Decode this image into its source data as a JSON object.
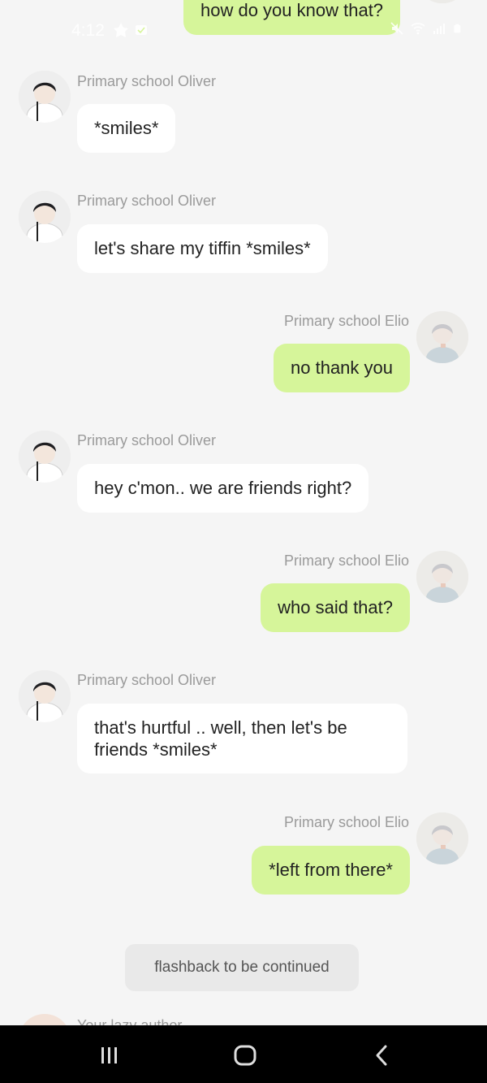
{
  "status_bar": {
    "time": "4:12"
  },
  "top_partial": {
    "text": "how do you know that?"
  },
  "messages": [
    {
      "sender": "Primary school Oliver",
      "text": "*smiles*"
    },
    {
      "sender": "Primary school Oliver",
      "text": "let's share my tiffin *smiles*"
    },
    {
      "sender": "Primary school Elio",
      "text": "no thank you"
    },
    {
      "sender": "Primary school Oliver",
      "text": "hey c'mon.. we are friends right?"
    },
    {
      "sender": "Primary school Elio",
      "text": "who said that?"
    },
    {
      "sender": "Primary school Oliver",
      "text": "that's hurtful .. well, then let's be friends *smiles*"
    },
    {
      "sender": "Primary school Elio",
      "text": "*left from there*"
    }
  ],
  "narration": {
    "text": "flashback to be continued"
  },
  "peek": {
    "sender": "Your lazy author"
  },
  "colors": {
    "outgoing_bubble": "#d6f59a",
    "incoming_bubble": "#ffffff",
    "background": "#f5f5f5"
  },
  "nav": {
    "recents_icon": "recents-icon",
    "home_icon": "home-icon",
    "back_icon": "back-icon"
  }
}
